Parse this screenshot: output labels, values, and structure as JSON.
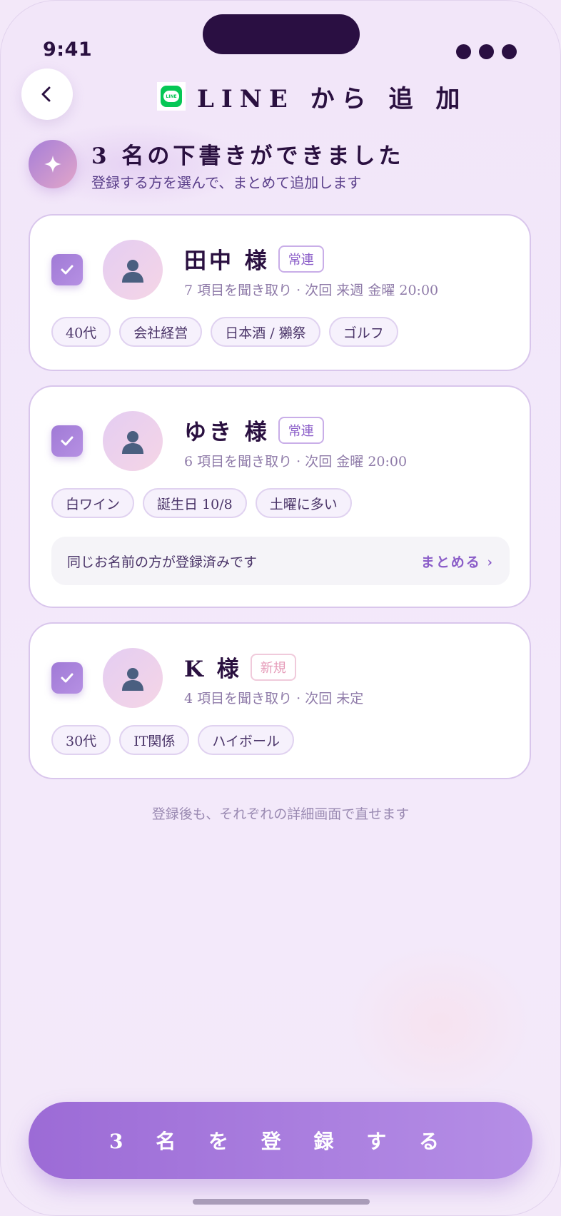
{
  "status_bar": {
    "time": "9:41"
  },
  "header": {
    "title": "LINE から 追 加",
    "logo_text": "LINE"
  },
  "summary": {
    "title": "3 名の下書きができました",
    "subtitle": "登録する方を選んで、まとめて追加します"
  },
  "cards": [
    {
      "name": "田中 様",
      "badge": "常連",
      "meta": "7 項目を聞き取り · 次回 来週 金曜 20:00",
      "checked": true,
      "tags": [
        "40代",
        "会社経営",
        "日本酒 / 獺祭",
        "ゴルフ"
      ]
    },
    {
      "name": "ゆき 様",
      "badge": "常連",
      "meta": "6 項目を聞き取り · 次回 金曜 20:00",
      "checked": true,
      "tags": [
        "白ワイン",
        "誕生日 10/8",
        "土曜に多い"
      ],
      "duplicate_notice": "同じお名前の方が登録済みです",
      "merge_label": "まとめる ›"
    },
    {
      "name": "K 様",
      "badge": "新規",
      "meta": "4 項目を聞き取り · 次回 未定",
      "checked": true,
      "tags": [
        "30代",
        "IT関係",
        "ハイボール"
      ]
    }
  ],
  "footnote": "登録後も、それぞれの詳細画面で直せます",
  "register_button": "3 名 を 登 録 す る",
  "colors": {
    "accent": "#9c6bd6",
    "text_dark": "#2a1040",
    "line_green": "#06c755",
    "badge_regular": "#8a5cc8",
    "badge_new": "#e59ab8"
  }
}
